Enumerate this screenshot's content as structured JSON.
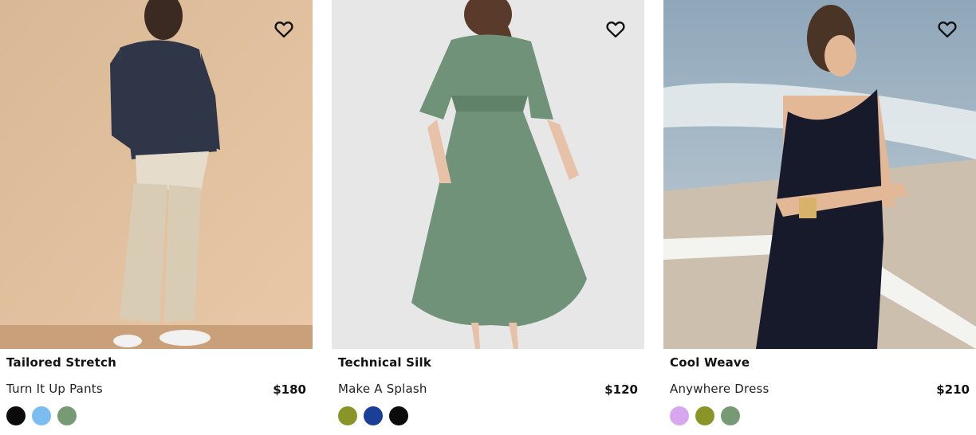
{
  "products": [
    {
      "name": "Tailored Stretch",
      "subtitle": "Turn It Up Pants",
      "price": "$180",
      "wishlist_icon": "heart-outline-icon",
      "swatches": [
        {
          "color": "#0b0b0b"
        },
        {
          "color": "#7bbdf0"
        },
        {
          "color": "#779a74"
        }
      ]
    },
    {
      "name": "Technical Silk",
      "subtitle": "Make A Splash",
      "price": "$120",
      "wishlist_icon": "heart-outline-icon",
      "swatches": [
        {
          "color": "#8a9527"
        },
        {
          "color": "#1a3f99"
        },
        {
          "color": "#0b0b0b"
        }
      ]
    },
    {
      "name": "Cool Weave",
      "subtitle": "Anywhere Dress",
      "price": "$210",
      "wishlist_icon": "heart-outline-icon",
      "swatches": [
        {
          "color": "#d9a7ef"
        },
        {
          "color": "#8a9527"
        },
        {
          "color": "#779a74"
        }
      ]
    }
  ]
}
